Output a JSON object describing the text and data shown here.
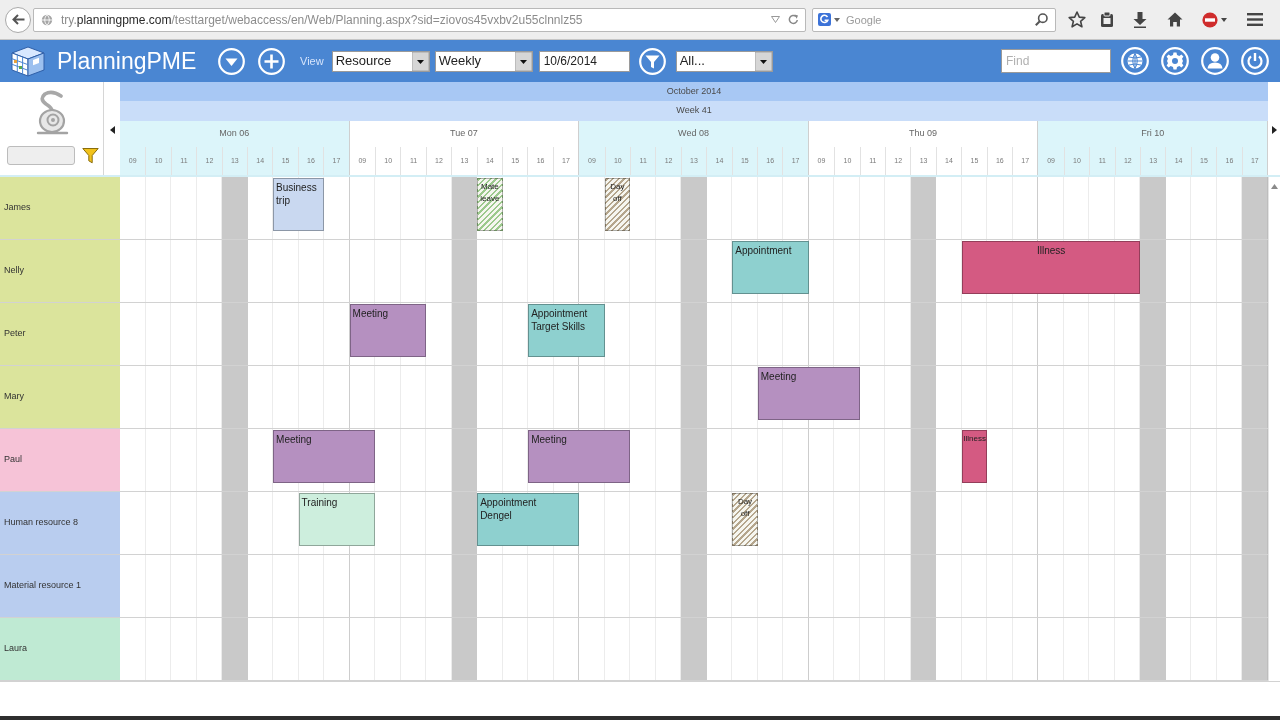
{
  "browser": {
    "url": "try.**planningpme.com**/testtarget/webaccess/en/Web/Planning.aspx?sid=ziovos45vxbv2u55clnnlz55",
    "search_placeholder": "Google"
  },
  "toolbar": {
    "app_name": "PlanningPME",
    "view_label": "View",
    "view_select": "Resource",
    "period_select": "Weekly",
    "date": "10/6/2014",
    "filter_select": "All...",
    "find_placeholder": "Find"
  },
  "calendar": {
    "month": "October 2014",
    "week": "Week 41",
    "days": [
      {
        "label": "Mon 06",
        "hours": [
          {
            "label": "09",
            "off": false
          },
          {
            "label": "10",
            "off": false
          },
          {
            "label": "11",
            "off": false
          },
          {
            "label": "12",
            "off": false
          },
          {
            "label": "13",
            "off": true
          },
          {
            "label": "14",
            "off": false
          },
          {
            "label": "15",
            "off": false
          },
          {
            "label": "16",
            "off": false
          },
          {
            "label": "17",
            "off": false
          }
        ]
      },
      {
        "label": "Tue 07",
        "hours": [
          {
            "label": "09",
            "off": false
          },
          {
            "label": "10",
            "off": false
          },
          {
            "label": "11",
            "off": false
          },
          {
            "label": "12",
            "off": false
          },
          {
            "label": "13",
            "off": true
          },
          {
            "label": "14",
            "off": false
          },
          {
            "label": "15",
            "off": false
          },
          {
            "label": "16",
            "off": false
          },
          {
            "label": "17",
            "off": false
          }
        ]
      },
      {
        "label": "Wed 08",
        "hours": [
          {
            "label": "09",
            "off": false
          },
          {
            "label": "10",
            "off": false
          },
          {
            "label": "11",
            "off": false
          },
          {
            "label": "12",
            "off": false
          },
          {
            "label": "13",
            "off": true
          },
          {
            "label": "14",
            "off": false
          },
          {
            "label": "15",
            "off": false
          },
          {
            "label": "16",
            "off": false
          },
          {
            "label": "17",
            "off": false
          }
        ]
      },
      {
        "label": "Thu 09",
        "hours": [
          {
            "label": "09",
            "off": false
          },
          {
            "label": "10",
            "off": false
          },
          {
            "label": "11",
            "off": false
          },
          {
            "label": "12",
            "off": false
          },
          {
            "label": "13",
            "off": true
          },
          {
            "label": "14",
            "off": false
          },
          {
            "label": "15",
            "off": false
          },
          {
            "label": "16",
            "off": false
          },
          {
            "label": "17",
            "off": false
          }
        ]
      },
      {
        "label": "Fri 10",
        "hours": [
          {
            "label": "09",
            "off": false
          },
          {
            "label": "10",
            "off": false
          },
          {
            "label": "11",
            "off": false
          },
          {
            "label": "12",
            "off": false
          },
          {
            "label": "13",
            "off": true
          },
          {
            "label": "14",
            "off": false
          },
          {
            "label": "15",
            "off": false
          },
          {
            "label": "16",
            "off": false
          },
          {
            "label": "17",
            "off": true
          }
        ]
      }
    ],
    "rows": [
      {
        "name": "James",
        "color": "#dbe49c",
        "timeline": [
          {
            "kind": "free"
          },
          {
            "kind": "free"
          },
          {
            "kind": "free"
          },
          {
            "kind": "free"
          },
          {
            "kind": "free"
          },
          {
            "kind": "free"
          },
          {
            "kind": "event",
            "event": {
              "label": "Business\ntrip",
              "kind": "task",
              "color": "#c9d8f0"
            }
          },
          {
            "kind": "more"
          },
          {
            "kind": "free"
          },
          {
            "kind": "free"
          },
          {
            "kind": "free"
          },
          {
            "kind": "free"
          },
          {
            "kind": "free"
          },
          {
            "kind": "free"
          },
          {
            "kind": "event",
            "event": {
              "label": "Mate\nleave",
              "kind": "leave",
              "color": "#9cc98d"
            }
          },
          {
            "kind": "free"
          },
          {
            "kind": "free"
          },
          {
            "kind": "free"
          },
          {
            "kind": "free"
          },
          {
            "kind": "event",
            "event": {
              "label": "Day\noff",
              "kind": "leave",
              "color": "#b5a68d"
            }
          },
          {
            "kind": "free"
          },
          {
            "kind": "free"
          },
          {
            "kind": "free"
          },
          {
            "kind": "free"
          },
          {
            "kind": "free"
          },
          {
            "kind": "free"
          },
          {
            "kind": "free"
          },
          {
            "kind": "free"
          },
          {
            "kind": "free"
          },
          {
            "kind": "free"
          },
          {
            "kind": "free"
          },
          {
            "kind": "free"
          },
          {
            "kind": "free"
          },
          {
            "kind": "free"
          },
          {
            "kind": "free"
          },
          {
            "kind": "free"
          },
          {
            "kind": "free"
          },
          {
            "kind": "free"
          },
          {
            "kind": "free"
          },
          {
            "kind": "free"
          },
          {
            "kind": "free"
          },
          {
            "kind": "free"
          },
          {
            "kind": "free"
          },
          {
            "kind": "free"
          },
          {
            "kind": "free"
          }
        ]
      },
      {
        "name": "Nelly",
        "color": "#dbe49c",
        "timeline": [
          {
            "kind": "free"
          },
          {
            "kind": "free"
          },
          {
            "kind": "free"
          },
          {
            "kind": "free"
          },
          {
            "kind": "free"
          },
          {
            "kind": "free"
          },
          {
            "kind": "free"
          },
          {
            "kind": "free"
          },
          {
            "kind": "free"
          },
          {
            "kind": "free"
          },
          {
            "kind": "free"
          },
          {
            "kind": "free"
          },
          {
            "kind": "free"
          },
          {
            "kind": "free"
          },
          {
            "kind": "free"
          },
          {
            "kind": "free"
          },
          {
            "kind": "free"
          },
          {
            "kind": "free"
          },
          {
            "kind": "free"
          },
          {
            "kind": "free"
          },
          {
            "kind": "free"
          },
          {
            "kind": "free"
          },
          {
            "kind": "free"
          },
          {
            "kind": "free"
          },
          {
            "kind": "event",
            "event": {
              "label": "Appointment",
              "kind": "task",
              "color": "#8ed0cf"
            }
          },
          {
            "kind": "more"
          },
          {
            "kind": "more"
          },
          {
            "kind": "free"
          },
          {
            "kind": "free"
          },
          {
            "kind": "free"
          },
          {
            "kind": "free"
          },
          {
            "kind": "free"
          },
          {
            "kind": "free"
          },
          {
            "kind": "event",
            "event": {
              "label": "Illness",
              "kind": "absence",
              "color": "#d45a82"
            }
          },
          {
            "kind": "more"
          },
          {
            "kind": "more"
          },
          {
            "kind": "more"
          },
          {
            "kind": "more"
          },
          {
            "kind": "more"
          },
          {
            "kind": "more"
          },
          {
            "kind": "free"
          },
          {
            "kind": "free"
          },
          {
            "kind": "free"
          },
          {
            "kind": "free"
          },
          {
            "kind": "free"
          }
        ]
      },
      {
        "name": "Peter",
        "color": "#dbe49c",
        "timeline": [
          {
            "kind": "free"
          },
          {
            "kind": "free"
          },
          {
            "kind": "free"
          },
          {
            "kind": "free"
          },
          {
            "kind": "free"
          },
          {
            "kind": "free"
          },
          {
            "kind": "free"
          },
          {
            "kind": "free"
          },
          {
            "kind": "free"
          },
          {
            "kind": "event",
            "event": {
              "label": "Meeting",
              "kind": "task",
              "color": "#b590c0"
            }
          },
          {
            "kind": "more"
          },
          {
            "kind": "more"
          },
          {
            "kind": "free"
          },
          {
            "kind": "free"
          },
          {
            "kind": "free"
          },
          {
            "kind": "free"
          },
          {
            "kind": "event",
            "event": {
              "label": "Appointment\nTarget Skills",
              "kind": "task",
              "color": "#8ed0cf"
            }
          },
          {
            "kind": "more"
          },
          {
            "kind": "more"
          },
          {
            "kind": "free"
          },
          {
            "kind": "free"
          },
          {
            "kind": "free"
          },
          {
            "kind": "free"
          },
          {
            "kind": "free"
          },
          {
            "kind": "free"
          },
          {
            "kind": "free"
          },
          {
            "kind": "free"
          },
          {
            "kind": "free"
          },
          {
            "kind": "free"
          },
          {
            "kind": "free"
          },
          {
            "kind": "free"
          },
          {
            "kind": "free"
          },
          {
            "kind": "free"
          },
          {
            "kind": "free"
          },
          {
            "kind": "free"
          },
          {
            "kind": "free"
          },
          {
            "kind": "free"
          },
          {
            "kind": "free"
          },
          {
            "kind": "free"
          },
          {
            "kind": "free"
          },
          {
            "kind": "free"
          },
          {
            "kind": "free"
          },
          {
            "kind": "free"
          },
          {
            "kind": "free"
          },
          {
            "kind": "free"
          }
        ]
      },
      {
        "name": "Mary",
        "color": "#dbe49c",
        "timeline": [
          {
            "kind": "free"
          },
          {
            "kind": "free"
          },
          {
            "kind": "free"
          },
          {
            "kind": "free"
          },
          {
            "kind": "free"
          },
          {
            "kind": "free"
          },
          {
            "kind": "free"
          },
          {
            "kind": "free"
          },
          {
            "kind": "free"
          },
          {
            "kind": "free"
          },
          {
            "kind": "free"
          },
          {
            "kind": "free"
          },
          {
            "kind": "free"
          },
          {
            "kind": "free"
          },
          {
            "kind": "free"
          },
          {
            "kind": "free"
          },
          {
            "kind": "free"
          },
          {
            "kind": "free"
          },
          {
            "kind": "free"
          },
          {
            "kind": "free"
          },
          {
            "kind": "free"
          },
          {
            "kind": "free"
          },
          {
            "kind": "free"
          },
          {
            "kind": "free"
          },
          {
            "kind": "free"
          },
          {
            "kind": "event",
            "event": {
              "label": "Meeting",
              "kind": "task",
              "color": "#b590c0"
            }
          },
          {
            "kind": "more"
          },
          {
            "kind": "more"
          },
          {
            "kind": "more"
          },
          {
            "kind": "free"
          },
          {
            "kind": "free"
          },
          {
            "kind": "free"
          },
          {
            "kind": "free"
          },
          {
            "kind": "free"
          },
          {
            "kind": "free"
          },
          {
            "kind": "free"
          },
          {
            "kind": "free"
          },
          {
            "kind": "free"
          },
          {
            "kind": "free"
          },
          {
            "kind": "free"
          },
          {
            "kind": "free"
          },
          {
            "kind": "free"
          },
          {
            "kind": "free"
          },
          {
            "kind": "free"
          },
          {
            "kind": "free"
          }
        ]
      },
      {
        "name": "Paul",
        "color": "#f6c3d7",
        "timeline": [
          {
            "kind": "free"
          },
          {
            "kind": "free"
          },
          {
            "kind": "free"
          },
          {
            "kind": "free"
          },
          {
            "kind": "free"
          },
          {
            "kind": "free"
          },
          {
            "kind": "event",
            "event": {
              "label": "Meeting",
              "kind": "task",
              "color": "#b590c0"
            }
          },
          {
            "kind": "more"
          },
          {
            "kind": "more"
          },
          {
            "kind": "more"
          },
          {
            "kind": "free"
          },
          {
            "kind": "free"
          },
          {
            "kind": "free"
          },
          {
            "kind": "free"
          },
          {
            "kind": "free"
          },
          {
            "kind": "free"
          },
          {
            "kind": "event",
            "event": {
              "label": "Meeting",
              "kind": "task",
              "color": "#b590c0"
            }
          },
          {
            "kind": "more"
          },
          {
            "kind": "more"
          },
          {
            "kind": "more"
          },
          {
            "kind": "free"
          },
          {
            "kind": "free"
          },
          {
            "kind": "free"
          },
          {
            "kind": "free"
          },
          {
            "kind": "free"
          },
          {
            "kind": "free"
          },
          {
            "kind": "free"
          },
          {
            "kind": "free"
          },
          {
            "kind": "free"
          },
          {
            "kind": "free"
          },
          {
            "kind": "free"
          },
          {
            "kind": "free"
          },
          {
            "kind": "free"
          },
          {
            "kind": "event",
            "event": {
              "label": "Illness",
              "kind": "absence",
              "color": "#d45a82"
            }
          },
          {
            "kind": "free"
          },
          {
            "kind": "free"
          },
          {
            "kind": "free"
          },
          {
            "kind": "free"
          },
          {
            "kind": "free"
          },
          {
            "kind": "free"
          },
          {
            "kind": "free"
          },
          {
            "kind": "free"
          },
          {
            "kind": "free"
          },
          {
            "kind": "free"
          },
          {
            "kind": "free"
          }
        ]
      },
      {
        "name": "Human resource 8",
        "color": "#b9cdef",
        "timeline": [
          {
            "kind": "free"
          },
          {
            "kind": "free"
          },
          {
            "kind": "free"
          },
          {
            "kind": "free"
          },
          {
            "kind": "free"
          },
          {
            "kind": "free"
          },
          {
            "kind": "free"
          },
          {
            "kind": "event",
            "event": {
              "label": "Training",
              "kind": "task",
              "color": "#cdeedd"
            }
          },
          {
            "kind": "more"
          },
          {
            "kind": "more"
          },
          {
            "kind": "free"
          },
          {
            "kind": "free"
          },
          {
            "kind": "free"
          },
          {
            "kind": "free"
          },
          {
            "kind": "event",
            "event": {
              "label": "Appointment\nDengel",
              "kind": "task",
              "color": "#8ed0cf"
            }
          },
          {
            "kind": "more"
          },
          {
            "kind": "more"
          },
          {
            "kind": "more"
          },
          {
            "kind": "free"
          },
          {
            "kind": "free"
          },
          {
            "kind": "free"
          },
          {
            "kind": "free"
          },
          {
            "kind": "free"
          },
          {
            "kind": "free"
          },
          {
            "kind": "event",
            "event": {
              "label": "Day\noff",
              "kind": "leave",
              "color": "#b5a68d"
            }
          },
          {
            "kind": "free"
          },
          {
            "kind": "free"
          },
          {
            "kind": "free"
          },
          {
            "kind": "free"
          },
          {
            "kind": "free"
          },
          {
            "kind": "free"
          },
          {
            "kind": "free"
          },
          {
            "kind": "free"
          },
          {
            "kind": "free"
          },
          {
            "kind": "free"
          },
          {
            "kind": "free"
          },
          {
            "kind": "free"
          },
          {
            "kind": "free"
          },
          {
            "kind": "free"
          },
          {
            "kind": "free"
          },
          {
            "kind": "free"
          },
          {
            "kind": "free"
          },
          {
            "kind": "free"
          },
          {
            "kind": "free"
          },
          {
            "kind": "free"
          }
        ]
      },
      {
        "name": "Material resource 1",
        "color": "#b9cdef",
        "timeline": [
          {
            "kind": "free"
          },
          {
            "kind": "free"
          },
          {
            "kind": "free"
          },
          {
            "kind": "free"
          },
          {
            "kind": "free"
          },
          {
            "kind": "free"
          },
          {
            "kind": "free"
          },
          {
            "kind": "free"
          },
          {
            "kind": "free"
          },
          {
            "kind": "free"
          },
          {
            "kind": "free"
          },
          {
            "kind": "free"
          },
          {
            "kind": "free"
          },
          {
            "kind": "free"
          },
          {
            "kind": "free"
          },
          {
            "kind": "free"
          },
          {
            "kind": "free"
          },
          {
            "kind": "free"
          },
          {
            "kind": "free"
          },
          {
            "kind": "free"
          },
          {
            "kind": "free"
          },
          {
            "kind": "free"
          },
          {
            "kind": "free"
          },
          {
            "kind": "free"
          },
          {
            "kind": "free"
          },
          {
            "kind": "free"
          },
          {
            "kind": "free"
          },
          {
            "kind": "free"
          },
          {
            "kind": "free"
          },
          {
            "kind": "free"
          },
          {
            "kind": "free"
          },
          {
            "kind": "free"
          },
          {
            "kind": "free"
          },
          {
            "kind": "free"
          },
          {
            "kind": "free"
          },
          {
            "kind": "free"
          },
          {
            "kind": "free"
          },
          {
            "kind": "free"
          },
          {
            "kind": "free"
          },
          {
            "kind": "free"
          },
          {
            "kind": "free"
          },
          {
            "kind": "free"
          },
          {
            "kind": "free"
          },
          {
            "kind": "free"
          },
          {
            "kind": "free"
          }
        ]
      },
      {
        "name": "Laura",
        "color": "#bfead3",
        "timeline": [
          {
            "kind": "free"
          },
          {
            "kind": "free"
          },
          {
            "kind": "free"
          },
          {
            "kind": "free"
          },
          {
            "kind": "free"
          },
          {
            "kind": "free"
          },
          {
            "kind": "free"
          },
          {
            "kind": "free"
          },
          {
            "kind": "free"
          },
          {
            "kind": "free"
          },
          {
            "kind": "free"
          },
          {
            "kind": "free"
          },
          {
            "kind": "free"
          },
          {
            "kind": "free"
          },
          {
            "kind": "free"
          },
          {
            "kind": "free"
          },
          {
            "kind": "free"
          },
          {
            "kind": "free"
          },
          {
            "kind": "free"
          },
          {
            "kind": "free"
          },
          {
            "kind": "free"
          },
          {
            "kind": "free"
          },
          {
            "kind": "free"
          },
          {
            "kind": "free"
          },
          {
            "kind": "free"
          },
          {
            "kind": "free"
          },
          {
            "kind": "free"
          },
          {
            "kind": "free"
          },
          {
            "kind": "free"
          },
          {
            "kind": "free"
          },
          {
            "kind": "free"
          },
          {
            "kind": "free"
          },
          {
            "kind": "free"
          },
          {
            "kind": "free"
          },
          {
            "kind": "free"
          },
          {
            "kind": "free"
          },
          {
            "kind": "free"
          },
          {
            "kind": "free"
          },
          {
            "kind": "free"
          },
          {
            "kind": "free"
          },
          {
            "kind": "free"
          },
          {
            "kind": "free"
          },
          {
            "kind": "free"
          },
          {
            "kind": "free"
          },
          {
            "kind": "free"
          }
        ]
      }
    ]
  }
}
